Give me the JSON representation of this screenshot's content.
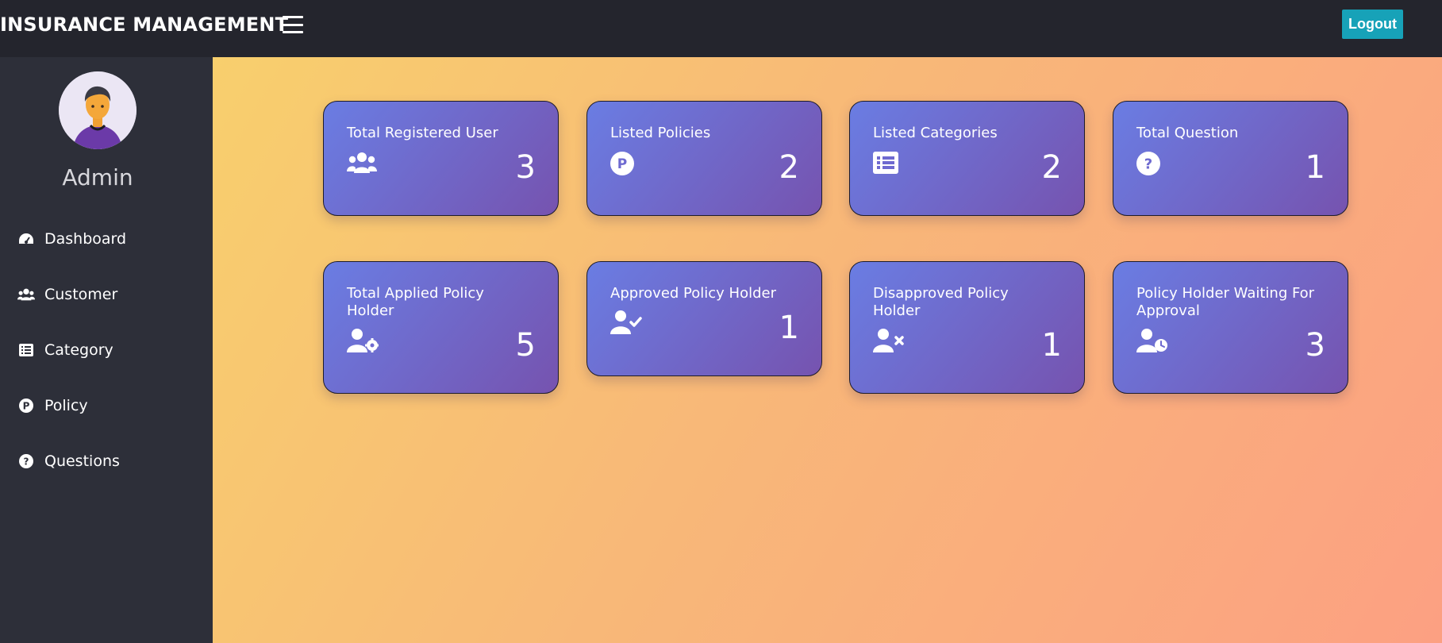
{
  "header": {
    "brand": "INSURANCE MANAGEMENT",
    "logout_label": "Logout"
  },
  "sidebar": {
    "admin_name": "Admin",
    "items": [
      {
        "label": "Dashboard",
        "icon": "dashboard-gauge-icon"
      },
      {
        "label": "Customer",
        "icon": "users-icon"
      },
      {
        "label": "Category",
        "icon": "list-icon"
      },
      {
        "label": "Policy",
        "icon": "parking-p-icon"
      },
      {
        "label": "Questions",
        "icon": "question-circle-icon"
      }
    ]
  },
  "cards": [
    {
      "title": "Total Registered User",
      "value": "3",
      "icon": "users-icon"
    },
    {
      "title": "Listed Policies",
      "value": "2",
      "icon": "parking-p-icon"
    },
    {
      "title": "Listed Categories",
      "value": "2",
      "icon": "list-icon"
    },
    {
      "title": "Total Question",
      "value": "1",
      "icon": "question-circle-icon"
    },
    {
      "title": "Total Applied Policy Holder",
      "value": "5",
      "icon": "user-cog-icon"
    },
    {
      "title": "Approved Policy Holder",
      "value": "1",
      "icon": "user-check-icon"
    },
    {
      "title": "Disapproved Policy Holder",
      "value": "1",
      "icon": "user-times-icon"
    },
    {
      "title": "Policy Holder Waiting For Approval",
      "value": "3",
      "icon": "user-clock-icon"
    }
  ],
  "colors": {
    "topbar": "#24252d",
    "sidebar": "#2d2f39",
    "logout": "#17a2b8",
    "card_start": "#6a7de3",
    "card_end": "#7653af"
  }
}
